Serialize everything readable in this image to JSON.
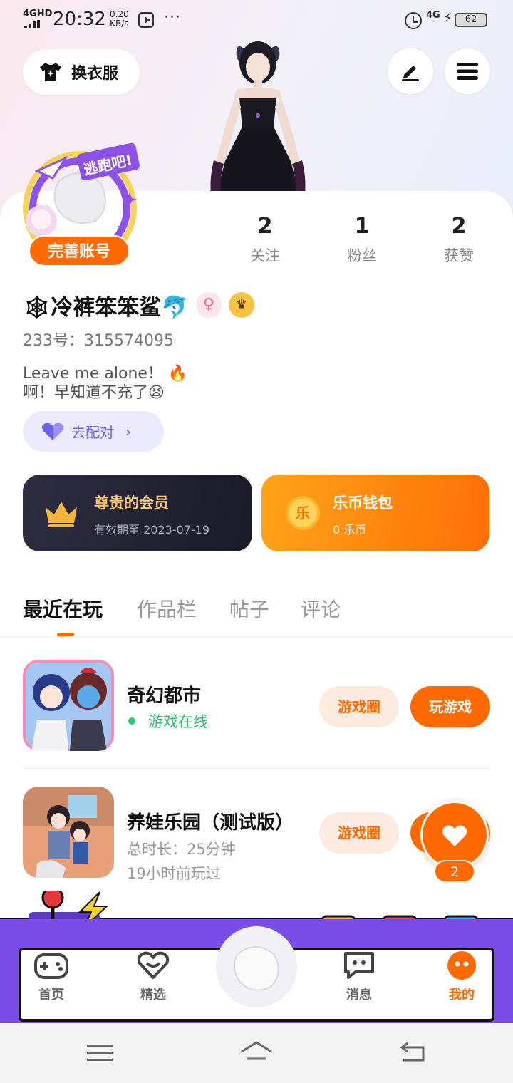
{
  "status_bar": {
    "network": "4GHD",
    "time": "20:32",
    "speed_value": "0.20",
    "speed_unit": "KB/s",
    "more": "···",
    "network_right": "4G",
    "battery": "62"
  },
  "header": {
    "outfit_label": "换衣服",
    "edit_icon": "pencil-icon",
    "menu_icon": "menu-icon"
  },
  "profile": {
    "complete_account_label": "完善账号",
    "badge_text": "逃跑吧!",
    "stats": [
      {
        "value": "2",
        "label": "关注"
      },
      {
        "value": "1",
        "label": "粉丝"
      },
      {
        "value": "2",
        "label": "获赞"
      }
    ],
    "nickname": "🕸冷裤笨笨鲨🐬",
    "gender_symbol": "♀",
    "uid": "233号：315574095",
    "bio_line1": "Leave me alone！ 🔥",
    "bio_line2": "啊！早知道不充了😫",
    "pair_label": "去配对",
    "pair_chevron": "›"
  },
  "membership": {
    "title": "尊贵的会员",
    "expiry": "有效期至 2023-07-19"
  },
  "wallet": {
    "coin_glyph": "乐",
    "title": "乐币钱包",
    "balance": "0 乐币"
  },
  "tabs": [
    {
      "label": "最近在玩",
      "active": true
    },
    {
      "label": "作品栏",
      "active": false
    },
    {
      "label": "帖子",
      "active": false
    },
    {
      "label": "评论",
      "active": false
    }
  ],
  "games": [
    {
      "name": "奇幻都市",
      "status": "游戏在线",
      "circle_label": "游戏圈",
      "play_label": "玩游戏"
    },
    {
      "name": "养娃乐园（测试版）",
      "duration": "总时长：25分钟",
      "last_played": "19小时前玩过",
      "circle_label": "游戏圈"
    }
  ],
  "like": {
    "count": "2"
  },
  "bottom_nav": {
    "items": [
      {
        "label": "首页",
        "icon": "gamepad-icon"
      },
      {
        "label": "精选",
        "icon": "heart-chat-icon"
      },
      {
        "label": "消息",
        "icon": "chat-icon"
      },
      {
        "label": "我的",
        "icon": "profile-face-icon"
      }
    ]
  },
  "colors": {
    "accent": "#ff6a00",
    "online": "#2ebd6b",
    "pair": "#6c64e8",
    "nav_frame": "#7a4de8"
  }
}
